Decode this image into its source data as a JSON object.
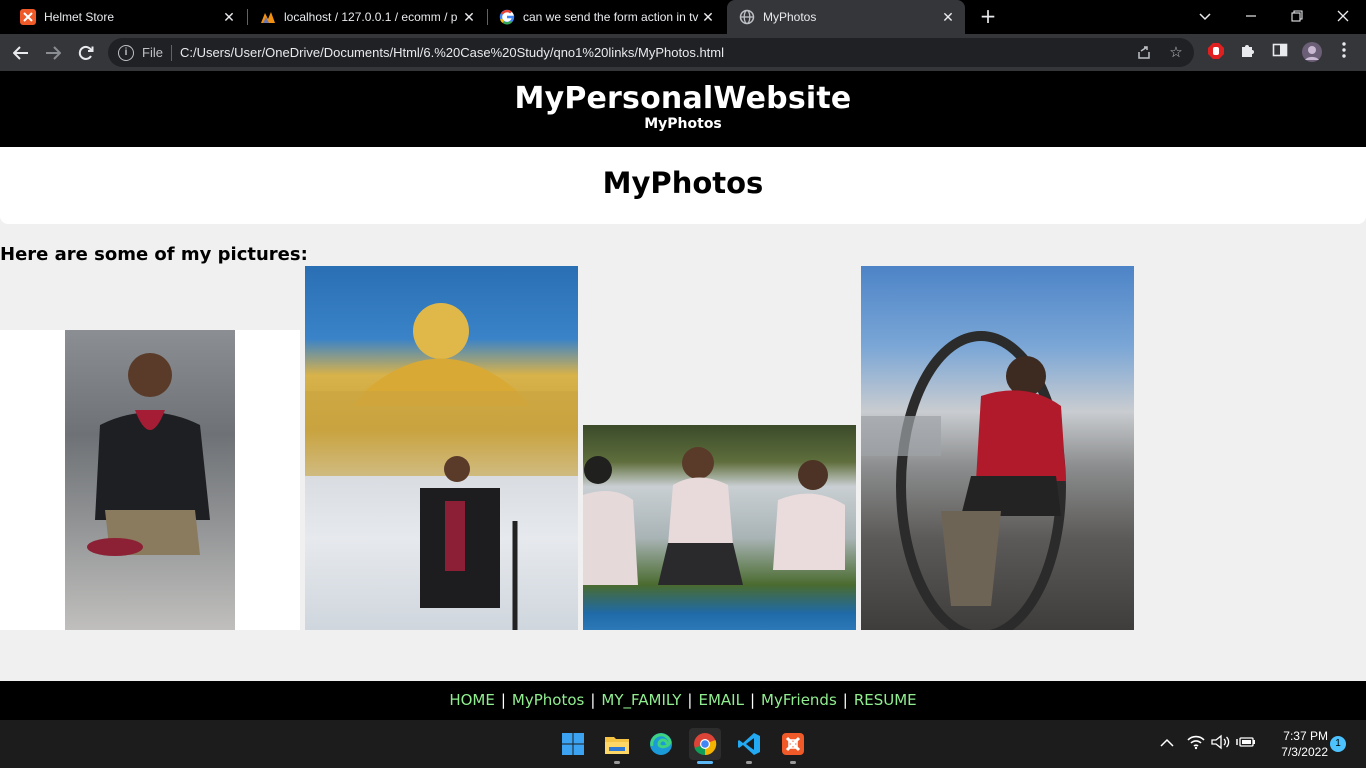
{
  "browser": {
    "tabs": [
      {
        "title": "Helmet Store",
        "active": false
      },
      {
        "title": "localhost / 127.0.0.1 / ecomm / p",
        "active": false
      },
      {
        "title": "can we send the form action in tv",
        "active": false
      },
      {
        "title": "MyPhotos",
        "active": true
      }
    ],
    "new_tab": "+",
    "file_label": "File",
    "url": "C:/Users/User/OneDrive/Documents/Html/6.%20Case%20Study/qno1%20links/MyPhotos.html"
  },
  "page": {
    "site_title": "MyPersonalWebsite",
    "site_subtitle": "MyPhotos",
    "heading": "MyPhotos",
    "intro": "Here are some of my pictures:",
    "footer_links": [
      {
        "label": "HOME"
      },
      {
        "label": "MyPhotos"
      },
      {
        "label": "MY_FAMILY"
      },
      {
        "label": "EMAIL"
      },
      {
        "label": "MyFriends"
      },
      {
        "label": "RESUME"
      }
    ],
    "footer_separator": "|",
    "link_color": "#90ee90"
  },
  "taskbar": {
    "time": "7:37 PM",
    "date": "7/3/2022",
    "notification_count": "1",
    "apps": [
      "windows-start-icon",
      "file-explorer-icon",
      "edge-icon",
      "chrome-icon",
      "vscode-icon",
      "xampp-icon"
    ]
  }
}
